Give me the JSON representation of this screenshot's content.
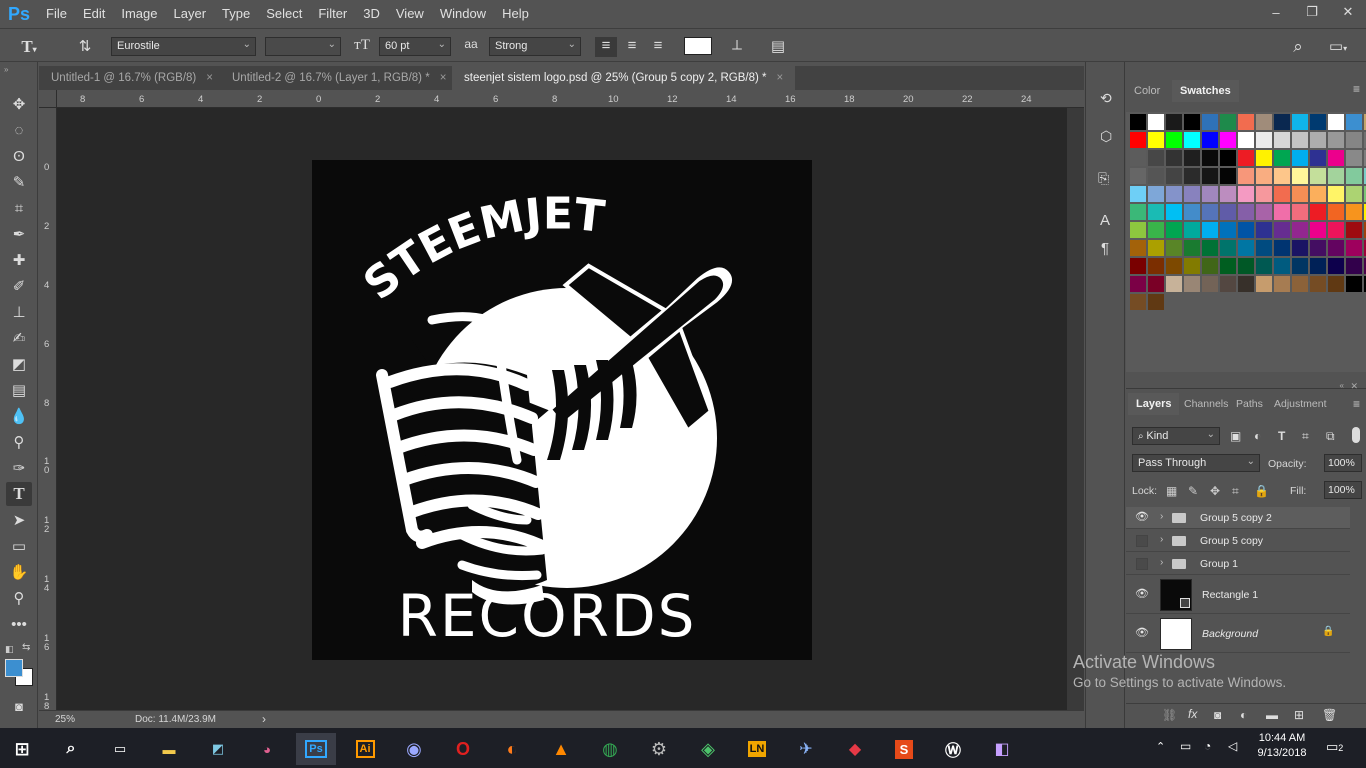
{
  "app": {
    "logo": "Ps",
    "menu": [
      "File",
      "Edit",
      "Image",
      "Layer",
      "Type",
      "Select",
      "Filter",
      "3D",
      "View",
      "Window",
      "Help"
    ]
  },
  "window_controls": {
    "minimize": "–",
    "restore": "❐",
    "close": "✕"
  },
  "options": {
    "font_family": "Eurostile",
    "font_style": "",
    "font_size": "60 pt",
    "anti_alias_icon": "aa",
    "anti_alias": "Strong",
    "text_color": "#ffffff"
  },
  "tabs": [
    {
      "label": "Untitled-1 @ 16.7% (RGB/8)",
      "close": "×",
      "active": false
    },
    {
      "label": "Untitled-2 @ 16.7% (Layer 1, RGB/8) *",
      "close": "×",
      "active": false
    },
    {
      "label": "steenjet sistem logo.psd @ 25% (Group 5 copy 2, RGB/8) *",
      "close": "×",
      "active": true
    }
  ],
  "ruler": {
    "top": [
      "8",
      "6",
      "4",
      "2",
      "0",
      "2",
      "4",
      "6",
      "8",
      "10",
      "12",
      "14",
      "16",
      "18",
      "20",
      "22",
      "24"
    ],
    "left": [
      "0",
      "2",
      "4",
      "6",
      "8",
      "1 0",
      "1 2",
      "1 4",
      "1 6",
      "1 8"
    ]
  },
  "logo": {
    "top_text": "STEEMJET",
    "bottom_text": "RECORDS"
  },
  "status": {
    "zoom": "25%",
    "doc": "Doc: 11.4M/23.9M",
    "arrow": "›"
  },
  "swatch_panel": {
    "tabs": [
      "Color",
      "Swatches"
    ],
    "active_tab": "Swatches"
  },
  "swatches": [
    [
      "#000000",
      "#ffffff",
      "#1a1a1a",
      "#000000",
      "#2f72b8",
      "#1e8a4b",
      "#f26c4f",
      "#a08c7a",
      "#0a2850",
      "#0fb5ea",
      "#003a70",
      "#ffffff",
      "#3c8fd0",
      "#c2a56b"
    ],
    [
      "#ff0000",
      "#ffff00",
      "#00ff00",
      "#00ffff",
      "#0000ff",
      "#ff00ff",
      "#ffffff",
      "#ebebeb",
      "#d6d6d6",
      "#c2c2c2",
      "#adadad",
      "#999999",
      "#858585",
      "#707070"
    ],
    [
      "#5c5c5c",
      "#474747",
      "#333333",
      "#1f1f1f",
      "#0a0a0a",
      "#000000",
      "#ed1c24",
      "#fff200",
      "#00a651",
      "#00aeef",
      "#2e3192",
      "#ec008c",
      "#898989",
      "#7d7d7d"
    ],
    [
      "#666666",
      "#555555",
      "#444444",
      "#2b2b2b",
      "#161616",
      "#050505",
      "#f7977a",
      "#f9ad81",
      "#fdc68a",
      "#fff79a",
      "#c4df9b",
      "#a3d39c",
      "#82ca9d",
      "#7bcdc8"
    ],
    [
      "#6ecff6",
      "#7ea7d8",
      "#8493ca",
      "#8882be",
      "#a187be",
      "#bc8dbf",
      "#f49ac2",
      "#f6989d",
      "#f26c4f",
      "#f68e55",
      "#fbaf5c",
      "#fff467",
      "#acd372",
      "#7cc576"
    ],
    [
      "#3bb878",
      "#1abbb4",
      "#00bff3",
      "#438cca",
      "#5574b9",
      "#605ca8",
      "#855fa8",
      "#a863a8",
      "#f06ea9",
      "#f26d7d",
      "#ed1c24",
      "#f26522",
      "#f7941d",
      "#fff200"
    ],
    [
      "#8dc63f",
      "#39b54a",
      "#00a651",
      "#00a99d",
      "#00aeef",
      "#0072bc",
      "#0054a6",
      "#2e3192",
      "#662d91",
      "#92278f",
      "#ec008c",
      "#ed145b",
      "#9e0b0f",
      "#a0410d"
    ],
    [
      "#a3620a",
      "#aba000",
      "#598527",
      "#1a7b30",
      "#007236",
      "#00746b",
      "#0076a3",
      "#004b80",
      "#003471",
      "#1b1464",
      "#440e62",
      "#630460",
      "#9e005d",
      "#9e0039"
    ],
    [
      "#790000",
      "#7b2e00",
      "#7d4900",
      "#827b00",
      "#406618",
      "#005e20",
      "#005826",
      "#005952",
      "#005b7f",
      "#003663",
      "#002157",
      "#0d004c",
      "#32004b",
      "#4b0049"
    ],
    [
      "#7b0046",
      "#7a0026",
      "#c7b299",
      "#998675",
      "#736357",
      "#534741",
      "#37302a",
      "#c69c6d",
      "#a67c52",
      "#8c6239",
      "#754c24",
      "#603913",
      "#000000",
      "#000000"
    ]
  ],
  "layers_panel": {
    "tabs": [
      "Layers",
      "Channels",
      "Paths",
      "Adjustment"
    ],
    "filter": "Kind",
    "blend_mode": "Pass Through",
    "opacity_label": "Opacity:",
    "opacity": "100%",
    "lock_label": "Lock:",
    "fill_label": "Fill:",
    "fill": "100%",
    "layers": [
      {
        "name": "Group 5 copy 2",
        "type": "group",
        "visible": true,
        "selected": true
      },
      {
        "name": "Group 5 copy",
        "type": "group",
        "visible": false,
        "selected": false
      },
      {
        "name": "Group 1",
        "type": "group",
        "visible": false,
        "selected": false
      },
      {
        "name": "Rectangle 1",
        "type": "shape",
        "visible": true,
        "selected": false
      },
      {
        "name": "Background",
        "type": "background",
        "visible": true,
        "selected": false
      }
    ]
  },
  "activate": {
    "title": "Activate Windows",
    "subtitle": "Go to Settings to activate Windows."
  },
  "taskbar": {
    "time": "10:44 AM",
    "date": "9/13/2018",
    "notifications": "2"
  },
  "colors": {
    "accent": "#31a8ff",
    "foreground": "#3c8fd0",
    "background": "#ffffff"
  }
}
